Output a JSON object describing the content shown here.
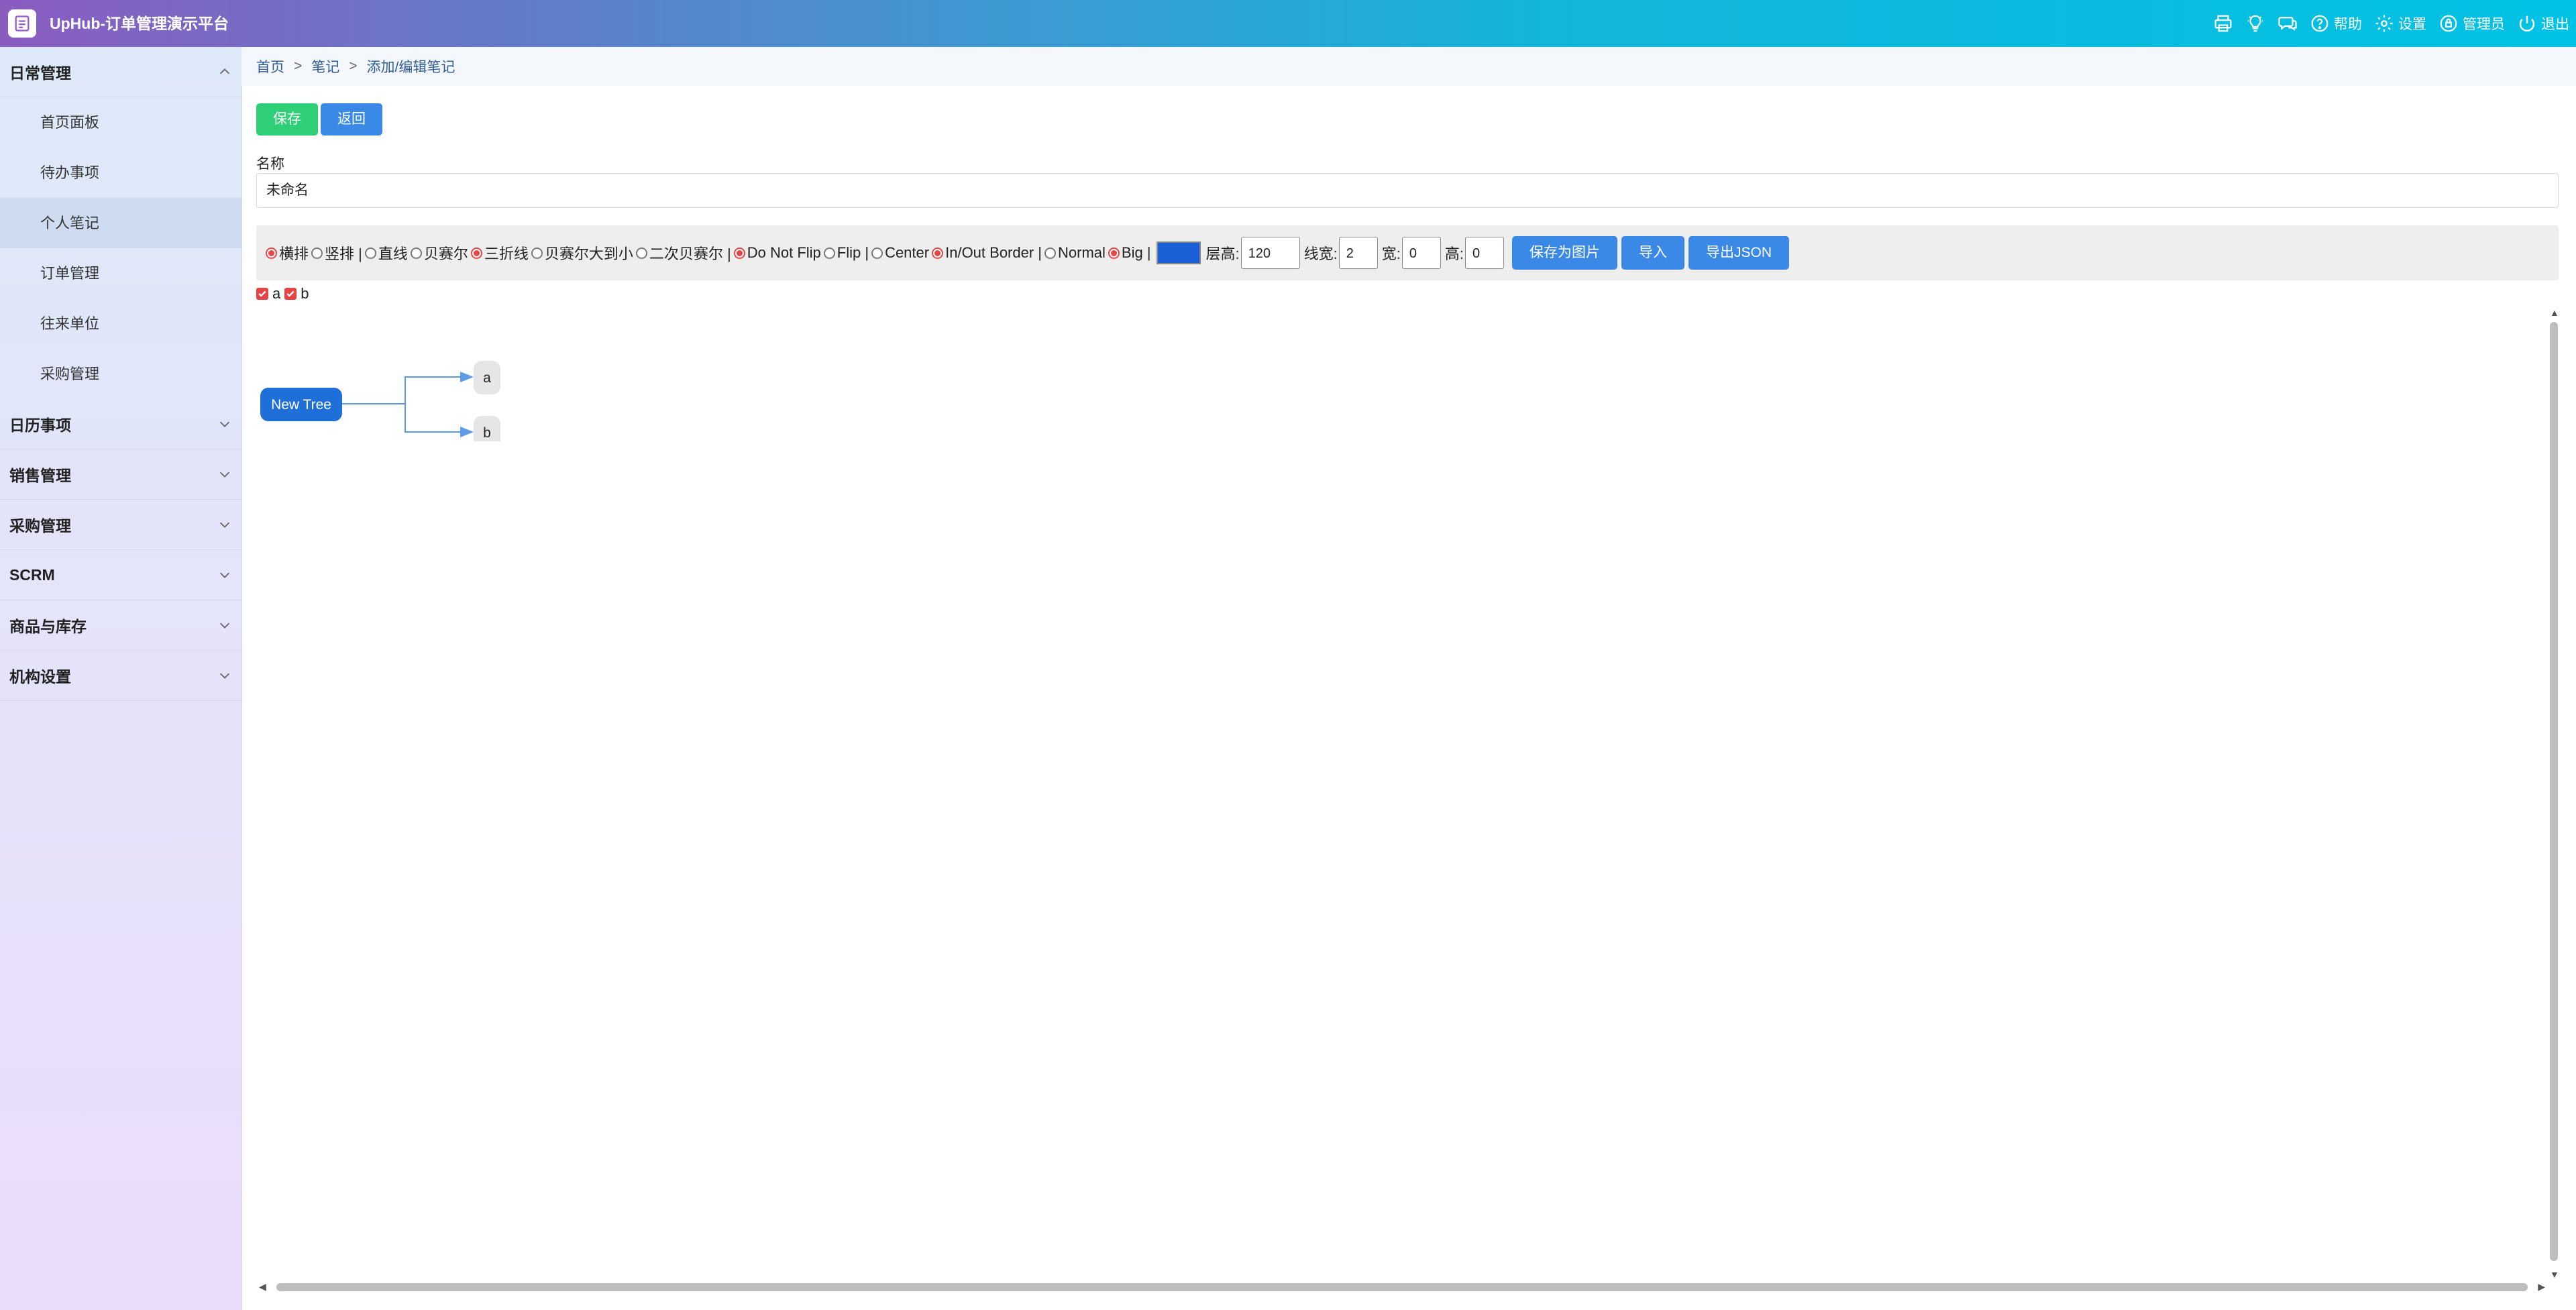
{
  "app": {
    "title": "UpHub-订单管理演示平台"
  },
  "header_actions": [
    {
      "icon": "printer-icon",
      "label": ""
    },
    {
      "icon": "bulb-icon",
      "label": ""
    },
    {
      "icon": "chat-icon",
      "label": ""
    },
    {
      "icon": "help-icon",
      "label": "帮助"
    },
    {
      "icon": "gear-icon",
      "label": "设置"
    },
    {
      "icon": "lock-icon",
      "label": "管理员"
    },
    {
      "icon": "power-icon",
      "label": "退出"
    }
  ],
  "sidebar": {
    "groups": [
      {
        "label": "日常管理",
        "expanded": true,
        "items": [
          {
            "label": "首页面板",
            "active": false
          },
          {
            "label": "待办事项",
            "active": false
          },
          {
            "label": "个人笔记",
            "active": true
          },
          {
            "label": "订单管理",
            "active": false
          },
          {
            "label": "往来单位",
            "active": false
          },
          {
            "label": "采购管理",
            "active": false
          }
        ]
      },
      {
        "label": "日历事项",
        "expanded": false
      },
      {
        "label": "销售管理",
        "expanded": false
      },
      {
        "label": "采购管理",
        "expanded": false
      },
      {
        "label": "SCRM",
        "expanded": false
      },
      {
        "label": "商品与库存",
        "expanded": false
      },
      {
        "label": "机构设置",
        "expanded": false
      }
    ]
  },
  "breadcrumb": {
    "home": "首页",
    "notes": "笔记",
    "current": "添加/编辑笔记",
    "separator": ">"
  },
  "actions": {
    "save": "保存",
    "back": "返回"
  },
  "form": {
    "name_label": "名称",
    "name_value": "未命名"
  },
  "toolbar": {
    "layout_options": [
      {
        "label": "横排",
        "checked": true
      },
      {
        "label": "竖排 |",
        "checked": false
      }
    ],
    "line_options": [
      {
        "label": "直线",
        "checked": false
      },
      {
        "label": "贝赛尔",
        "checked": false
      },
      {
        "label": "三折线",
        "checked": true
      },
      {
        "label": "贝赛尔大到小",
        "checked": false
      },
      {
        "label": "二次贝赛尔 |",
        "checked": false
      }
    ],
    "flip_options": [
      {
        "label": "Do Not Flip",
        "checked": true
      },
      {
        "label": "Flip |",
        "checked": false
      }
    ],
    "align_options": [
      {
        "label": "Center",
        "checked": false
      },
      {
        "label": "In/Out Border |",
        "checked": true
      }
    ],
    "size_options": [
      {
        "label": "Normal",
        "checked": false
      },
      {
        "label": "Big |",
        "checked": true
      }
    ],
    "color": "#1a5fd6",
    "level_height_label": "层高:",
    "level_height_value": "120",
    "line_width_label": "线宽:",
    "line_width_value": "2",
    "width_label": "宽:",
    "width_value": "0",
    "height_label": "高:",
    "height_value": "0",
    "save_image": "保存为图片",
    "import": "导入",
    "export_json": "导出JSON"
  },
  "checkboxes": [
    {
      "label": "a",
      "checked": true
    },
    {
      "label": "b",
      "checked": true
    }
  ],
  "tree": {
    "root": "New Tree",
    "children": [
      "a",
      "b"
    ],
    "root_color": "#1f6fd8",
    "child_color": "#e6e6e6",
    "line_color": "#5b9be8"
  }
}
